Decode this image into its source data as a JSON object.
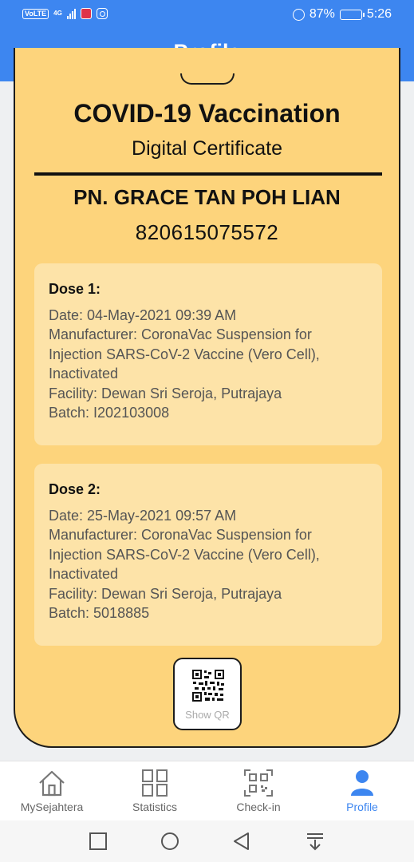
{
  "status_bar": {
    "network_badge": "VoLTE",
    "signal_label": "4G",
    "battery": "87%",
    "time": "5:26",
    "battery_level": 0.87
  },
  "header": {
    "title": "Profile",
    "menu_icon": "hamburger-icon"
  },
  "certificate": {
    "title": "COVID-19 Vaccination",
    "subtitle": "Digital Certificate",
    "holder_name": "PN. GRACE TAN POH LIAN",
    "holder_id": "820615075572",
    "doses": [
      {
        "title": "Dose 1:",
        "date": "Date: 04-May-2021 09:39 AM",
        "manufacturer_1": "Manufacturer: CoronaVac Suspension for",
        "manufacturer_2": "Injection SARS-CoV-2 Vaccine (Vero Cell),",
        "manufacturer_3": "Inactivated",
        "facility": "Facility: Dewan Sri Seroja, Putrajaya",
        "batch": "Batch: I202103008"
      },
      {
        "title": "Dose 2:",
        "date": "Date: 25-May-2021 09:57 AM",
        "manufacturer_1": "Manufacturer: CoronaVac Suspension for",
        "manufacturer_2": "Injection SARS-CoV-2 Vaccine (Vero Cell),",
        "manufacturer_3": "Inactivated",
        "facility": "Facility: Dewan Sri Seroja, Putrajaya",
        "batch": "Batch: 5018885"
      }
    ],
    "qr_button_label": "Show QR"
  },
  "bottom_nav": {
    "items": [
      {
        "label": "MySejahtera",
        "icon": "home-icon",
        "active": false
      },
      {
        "label": "Statistics",
        "icon": "grid-icon",
        "active": false
      },
      {
        "label": "Check-in",
        "icon": "qr-scan-icon",
        "active": false
      },
      {
        "label": "Profile",
        "icon": "person-icon",
        "active": true
      }
    ]
  },
  "colors": {
    "header_blue": "#3d86f0",
    "card_yellow": "#fdd47c",
    "dose_panel": "#fde3a8"
  }
}
